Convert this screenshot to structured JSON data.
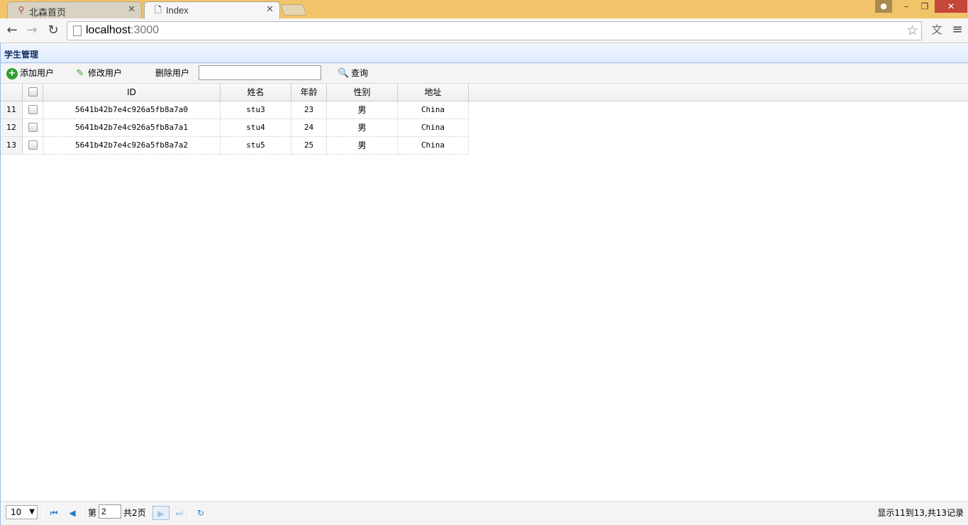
{
  "browser": {
    "tabs": [
      {
        "title": "北森首页",
        "active": false,
        "icon": "logo-icon"
      },
      {
        "title": "Index",
        "active": true,
        "icon": "page-icon"
      }
    ],
    "url_host": "localhost",
    "url_port": ":3000"
  },
  "panel": {
    "title": "学生管理"
  },
  "toolbar": {
    "add_label": "添加用户",
    "edit_label": "修改用户",
    "delete_label": "删除用户",
    "query_label": "查询",
    "search_value": ""
  },
  "grid": {
    "columns": {
      "id": "ID",
      "name": "姓名",
      "age": "年龄",
      "sex": "性别",
      "address": "地址"
    },
    "rows": [
      {
        "num": "11",
        "id": "5641b42b7e4c926a5fb8a7a0",
        "name": "stu3",
        "age": "23",
        "sex": "男",
        "address": "China"
      },
      {
        "num": "12",
        "id": "5641b42b7e4c926a5fb8a7a1",
        "name": "stu4",
        "age": "24",
        "sex": "男",
        "address": "China"
      },
      {
        "num": "13",
        "id": "5641b42b7e4c926a5fb8a7a2",
        "name": "stu5",
        "age": "25",
        "sex": "男",
        "address": "China"
      }
    ]
  },
  "pager": {
    "page_size": "10",
    "page_prefix": "第",
    "current_page": "2",
    "page_total": "共2页",
    "info": "显示11到13,共13记录"
  }
}
